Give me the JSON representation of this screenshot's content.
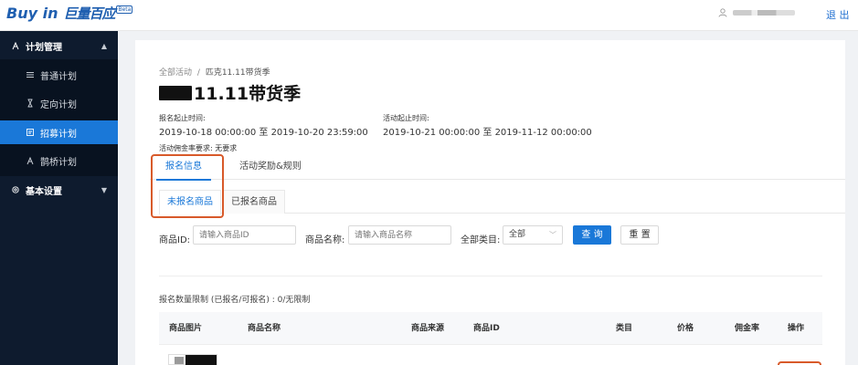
{
  "header": {
    "logo_en": "Buy in",
    "logo_cn": "巨量百应",
    "logo_badge": "Beta",
    "logout": "退 出"
  },
  "sidebar": {
    "items": [
      {
        "label": "计划管理",
        "icon": "plan-icon"
      },
      {
        "label": "普通计划",
        "icon": "list-icon"
      },
      {
        "label": "定向计划",
        "icon": "hourglass-icon"
      },
      {
        "label": "招募计划",
        "icon": "recruit-icon"
      },
      {
        "label": "鹊桥计划",
        "icon": "bridge-icon"
      },
      {
        "label": "基本设置",
        "icon": "gear-icon"
      }
    ]
  },
  "breadcrumb": {
    "root": "全部活动",
    "sep": "/",
    "current": "匹克11.11带货季"
  },
  "title": "11.11带货季",
  "info": {
    "signup_label": "报名起止时间:",
    "signup_value": "2019-10-18 00:00:00 至 2019-10-20 23:59:00",
    "activity_label": "活动起止时间:",
    "activity_value": "2019-10-21 00:00:00 至 2019-11-12 00:00:00",
    "commission_label": "活动佣金率要求: 无要求"
  },
  "tabs": [
    "报名信息",
    "活动奖励&规则"
  ],
  "subtabs": [
    "未报名商品",
    "已报名商品"
  ],
  "filters": {
    "id_label": "商品ID:",
    "id_placeholder": "请输入商品ID",
    "name_label": "商品名称:",
    "name_placeholder": "请输入商品名称",
    "category_label": "全部类目:",
    "category_value": "全部",
    "search": "查 询",
    "reset": "重 置"
  },
  "quota": "报名数量限制 (已报名/可报名) : 0/无限制",
  "table": {
    "columns": [
      "商品图片",
      "商品名称",
      "商品来源",
      "商品ID",
      "类目",
      "价格",
      "佣金率",
      "操作"
    ]
  },
  "colors": {
    "primary": "#1a78d8",
    "sidebar_bg": "#0e1b2e",
    "highlight": "#d85a2a"
  }
}
